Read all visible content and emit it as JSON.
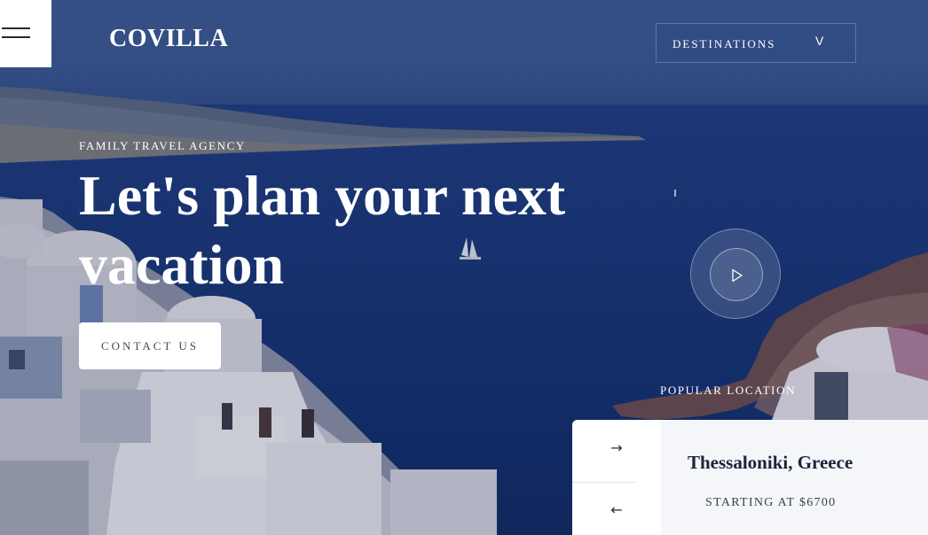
{
  "header": {
    "logo": "COVILLA",
    "destinations_label": "DESTINATIONS",
    "destinations_chevron": "V"
  },
  "hero": {
    "eyebrow": "FAMILY TRAVEL AGENCY",
    "headline_line1": "Let's plan your next",
    "headline_line2": "vacation",
    "cta_label": "CONTACT US"
  },
  "popular": {
    "title": "POPULAR LOCATION",
    "location": "Thessaloniki, Greece",
    "price": "STARTING AT $6700",
    "next_arrow": "→",
    "prev_arrow": "←"
  },
  "icons": {
    "menu": "hamburger-icon",
    "play": "play-icon"
  },
  "colors": {
    "sea": "#183777",
    "card_bg": "#f5f6fa",
    "text_dark": "#1d2237",
    "white": "#ffffff"
  }
}
